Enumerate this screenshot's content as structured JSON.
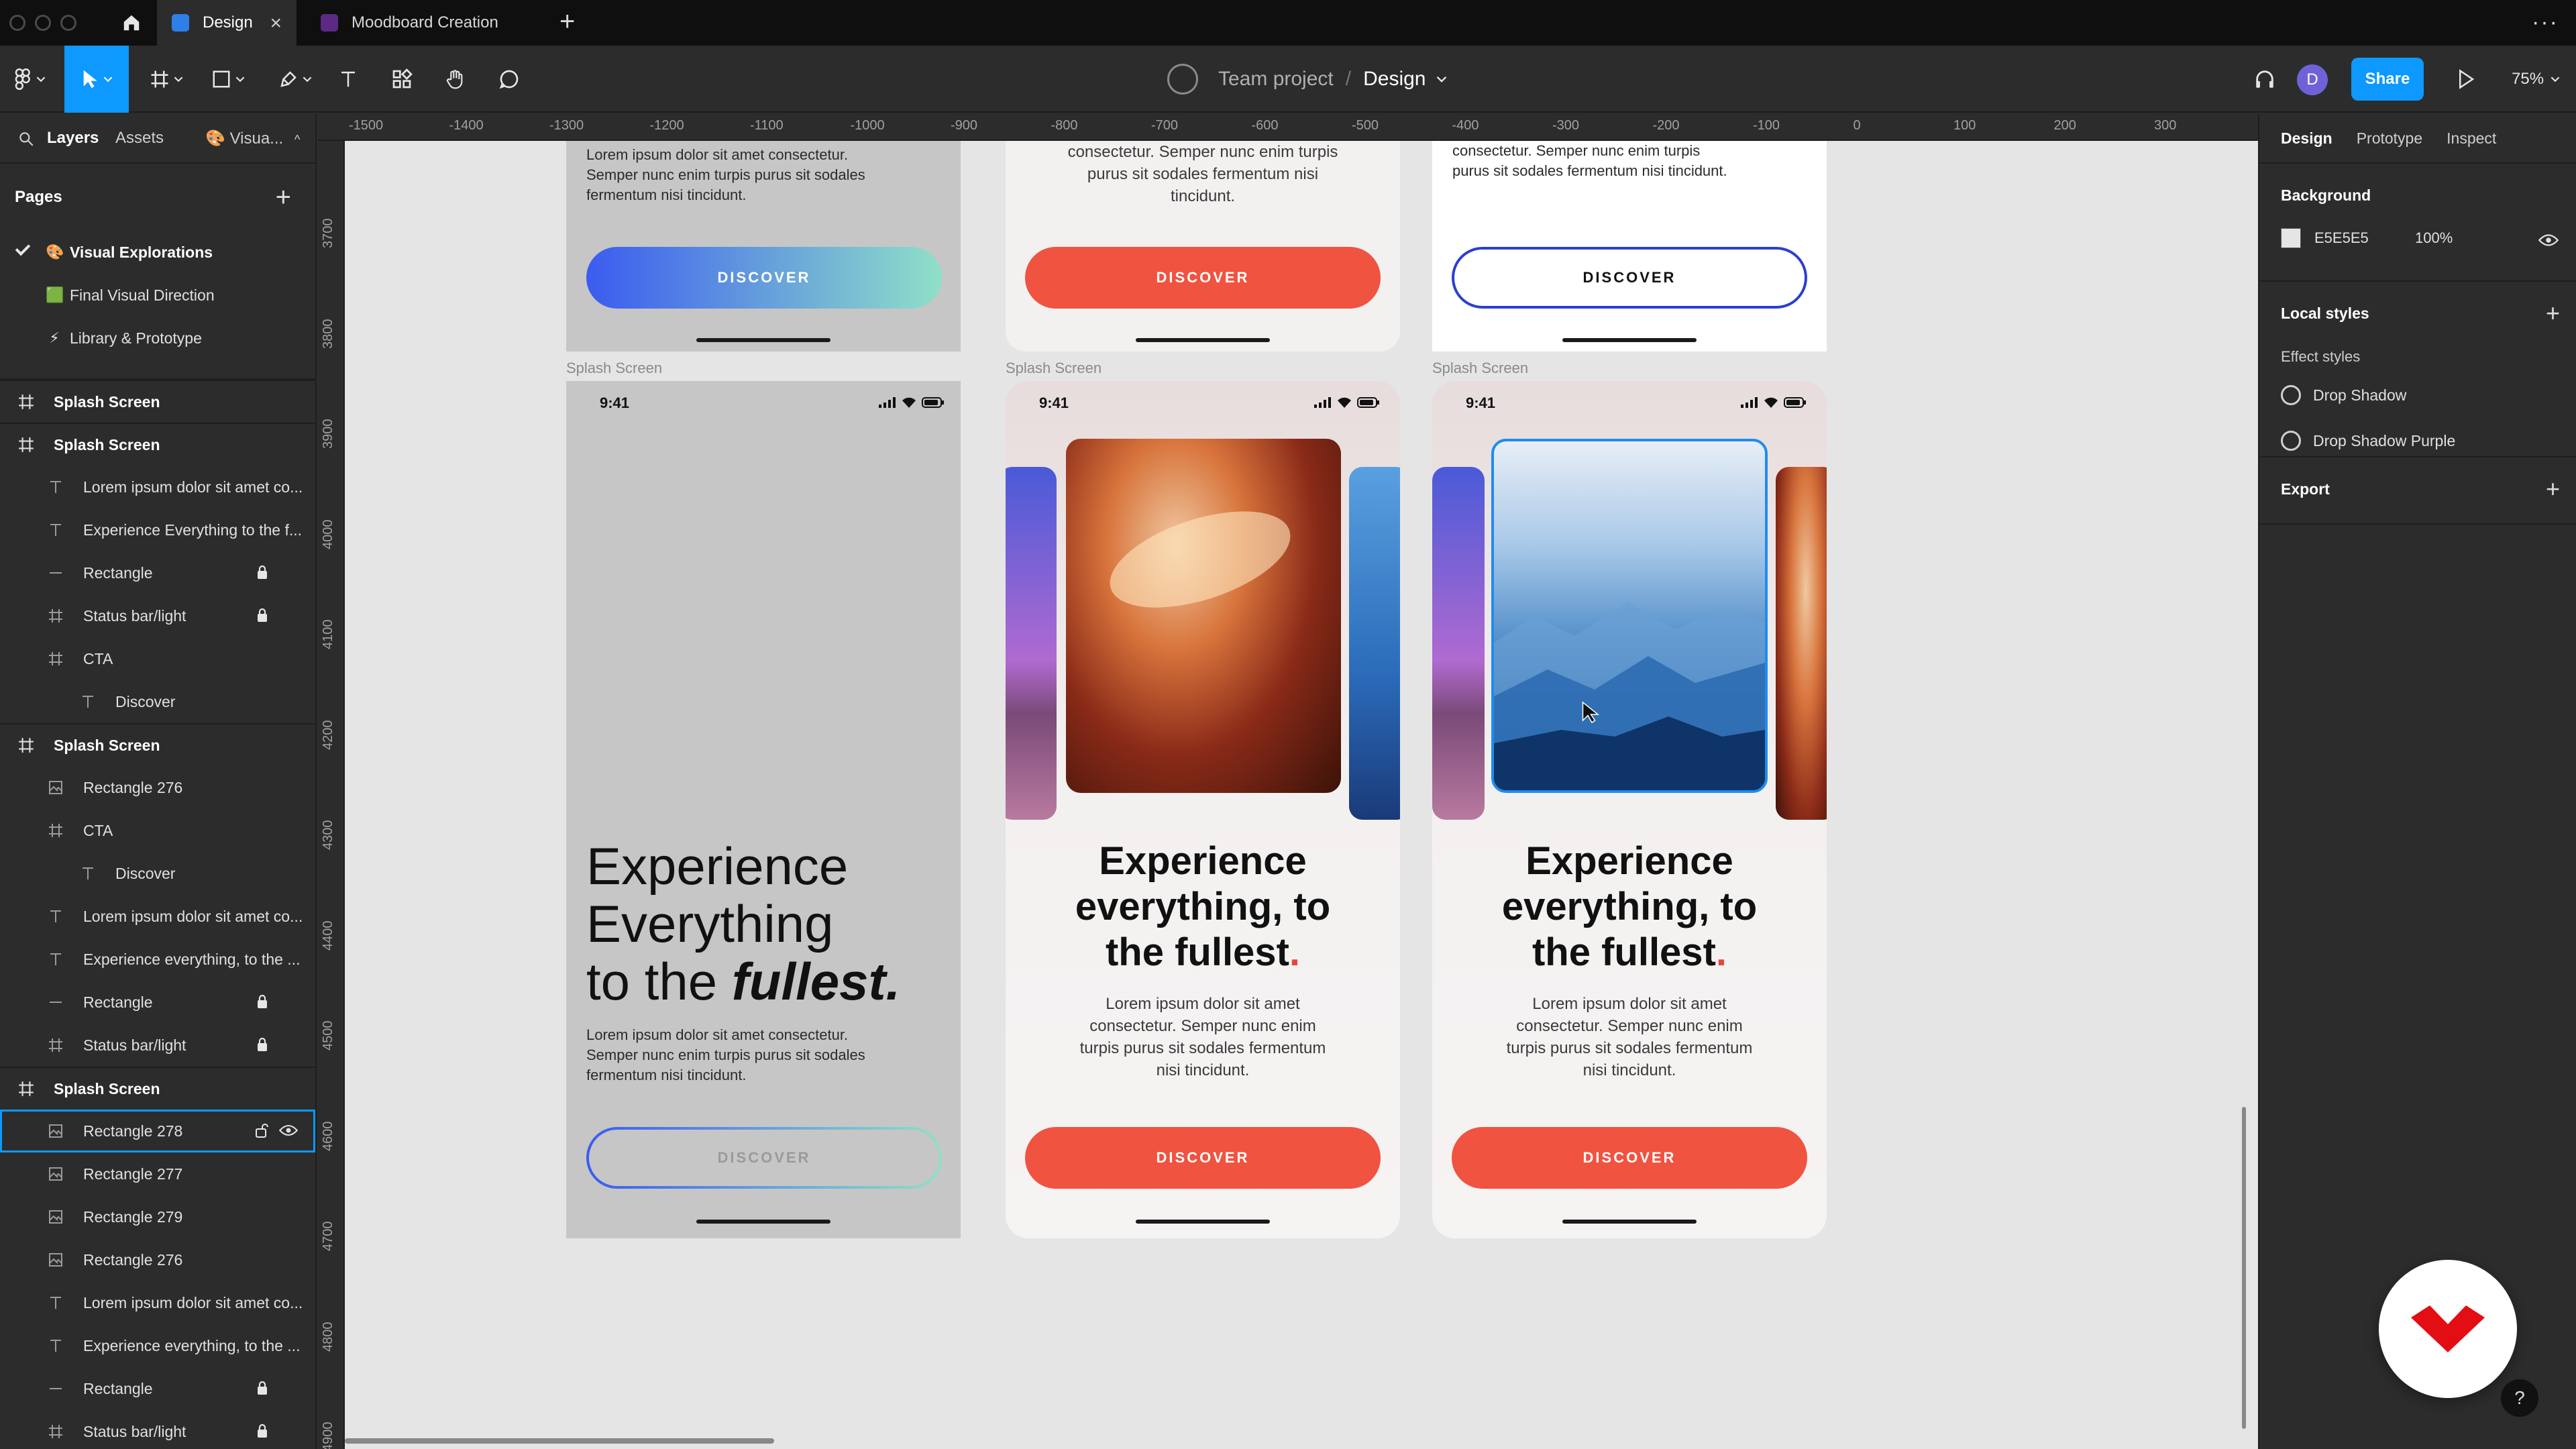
{
  "window": {
    "tabs": [
      {
        "label": "Design",
        "active": true
      },
      {
        "label": "Moodboard Creation",
        "active": false
      }
    ]
  },
  "toolbar": {
    "project": "Team project",
    "separator": "/",
    "file": "Design",
    "share_label": "Share",
    "user_initial": "D",
    "zoom": "75%"
  },
  "left_panel": {
    "tabs": {
      "layers": "Layers",
      "assets": "Assets",
      "page": "Visua..."
    },
    "pages_title": "Pages",
    "pages": [
      {
        "emoji": "🎨",
        "label": "Visual Explorations",
        "current": true
      },
      {
        "emoji": "🟩",
        "label": "Final Visual Direction",
        "current": false
      },
      {
        "emoji": "⚡",
        "label": "Library & Prototype",
        "current": false
      }
    ],
    "layers": [
      {
        "type": "frame",
        "label": "Splash Screen",
        "indent": 0
      },
      {
        "type": "frame",
        "label": "Splash Screen",
        "indent": 0
      },
      {
        "type": "text",
        "label": "Lorem ipsum dolor sit amet co...",
        "indent": 1
      },
      {
        "type": "text",
        "label": "Experience Everything to the f...",
        "indent": 1
      },
      {
        "type": "line",
        "label": "Rectangle",
        "indent": 1,
        "locked": true
      },
      {
        "type": "frame-child",
        "label": "Status bar/light",
        "indent": 1,
        "locked": true
      },
      {
        "type": "frame-child",
        "label": "CTA",
        "indent": 1
      },
      {
        "type": "text",
        "label": "Discover",
        "indent": 2
      },
      {
        "type": "frame",
        "label": "Splash Screen",
        "indent": 0
      },
      {
        "type": "image",
        "label": "Rectangle 276",
        "indent": 1
      },
      {
        "type": "frame-child",
        "label": "CTA",
        "indent": 1
      },
      {
        "type": "text",
        "label": "Discover",
        "indent": 2
      },
      {
        "type": "text",
        "label": "Lorem ipsum dolor sit amet co...",
        "indent": 1
      },
      {
        "type": "text",
        "label": "Experience everything, to the ...",
        "indent": 1
      },
      {
        "type": "line",
        "label": "Rectangle",
        "indent": 1,
        "locked": true
      },
      {
        "type": "frame-child",
        "label": "Status bar/light",
        "indent": 1,
        "locked": true
      },
      {
        "type": "frame",
        "label": "Splash Screen",
        "indent": 0
      },
      {
        "type": "image",
        "label": "Rectangle 278",
        "indent": 1,
        "selected": true
      },
      {
        "type": "image",
        "label": "Rectangle 277",
        "indent": 1
      },
      {
        "type": "image",
        "label": "Rectangle 279",
        "indent": 1
      },
      {
        "type": "image",
        "label": "Rectangle 276",
        "indent": 1
      },
      {
        "type": "text",
        "label": "Lorem ipsum dolor sit amet co...",
        "indent": 1
      },
      {
        "type": "text",
        "label": "Experience everything, to the ...",
        "indent": 1
      },
      {
        "type": "line",
        "label": "Rectangle",
        "indent": 1,
        "locked": true
      },
      {
        "type": "frame-child",
        "label": "Status bar/light",
        "indent": 1,
        "locked": true
      }
    ]
  },
  "rulers": {
    "top": [
      "-1500",
      "-1400",
      "-1300",
      "-1200",
      "-1100",
      "-1000",
      "-900",
      "-800",
      "-700",
      "-600",
      "-500",
      "-400",
      "-300",
      "-200",
      "-100",
      "0",
      "100",
      "200",
      "300"
    ],
    "left": [
      "3700",
      "3800",
      "3900",
      "4000",
      "4100",
      "4200",
      "4300",
      "4400",
      "4500",
      "4600",
      "4700",
      "4800",
      "4900"
    ]
  },
  "canvas": {
    "frame_label": "Splash Screen",
    "top_partial_text_left": "Lorem ipsum dolor sit amet consectetur. Semper nunc enim turpis purus sit sodales fermentum nisi tincidunt.",
    "top_partial_text_center": "consectetur. Semper nunc enim turpis purus sit sodales fermentum nisi tincidunt.",
    "cta_label": "DISCOVER",
    "status_time": "9:41",
    "left_headline_1": "Experience",
    "left_headline_2": "Everything",
    "left_headline_3a": "to the ",
    "left_headline_3b": "fullest.",
    "body": "Lorem ipsum dolor sit amet consectetur. Semper nunc enim turpis purus sit sodales fermentum nisi tincidunt.",
    "center_headline_1": "Experience",
    "center_headline_2": "everything, to",
    "center_headline_3": "the fullest",
    "headline_dot": "."
  },
  "right_panel": {
    "tabs": [
      "Design",
      "Prototype",
      "Inspect"
    ],
    "background_title": "Background",
    "background_hex": "E5E5E5",
    "background_opacity": "100%",
    "local_styles": "Local styles",
    "effect_styles": "Effect styles",
    "effects": [
      "Drop Shadow",
      "Drop Shadow Purple"
    ],
    "export": "Export"
  },
  "help_label": "?",
  "colors": {
    "accent": "#0d99ff",
    "cta_red": "#f05340",
    "canvas_bg": "#e5e5e5"
  }
}
